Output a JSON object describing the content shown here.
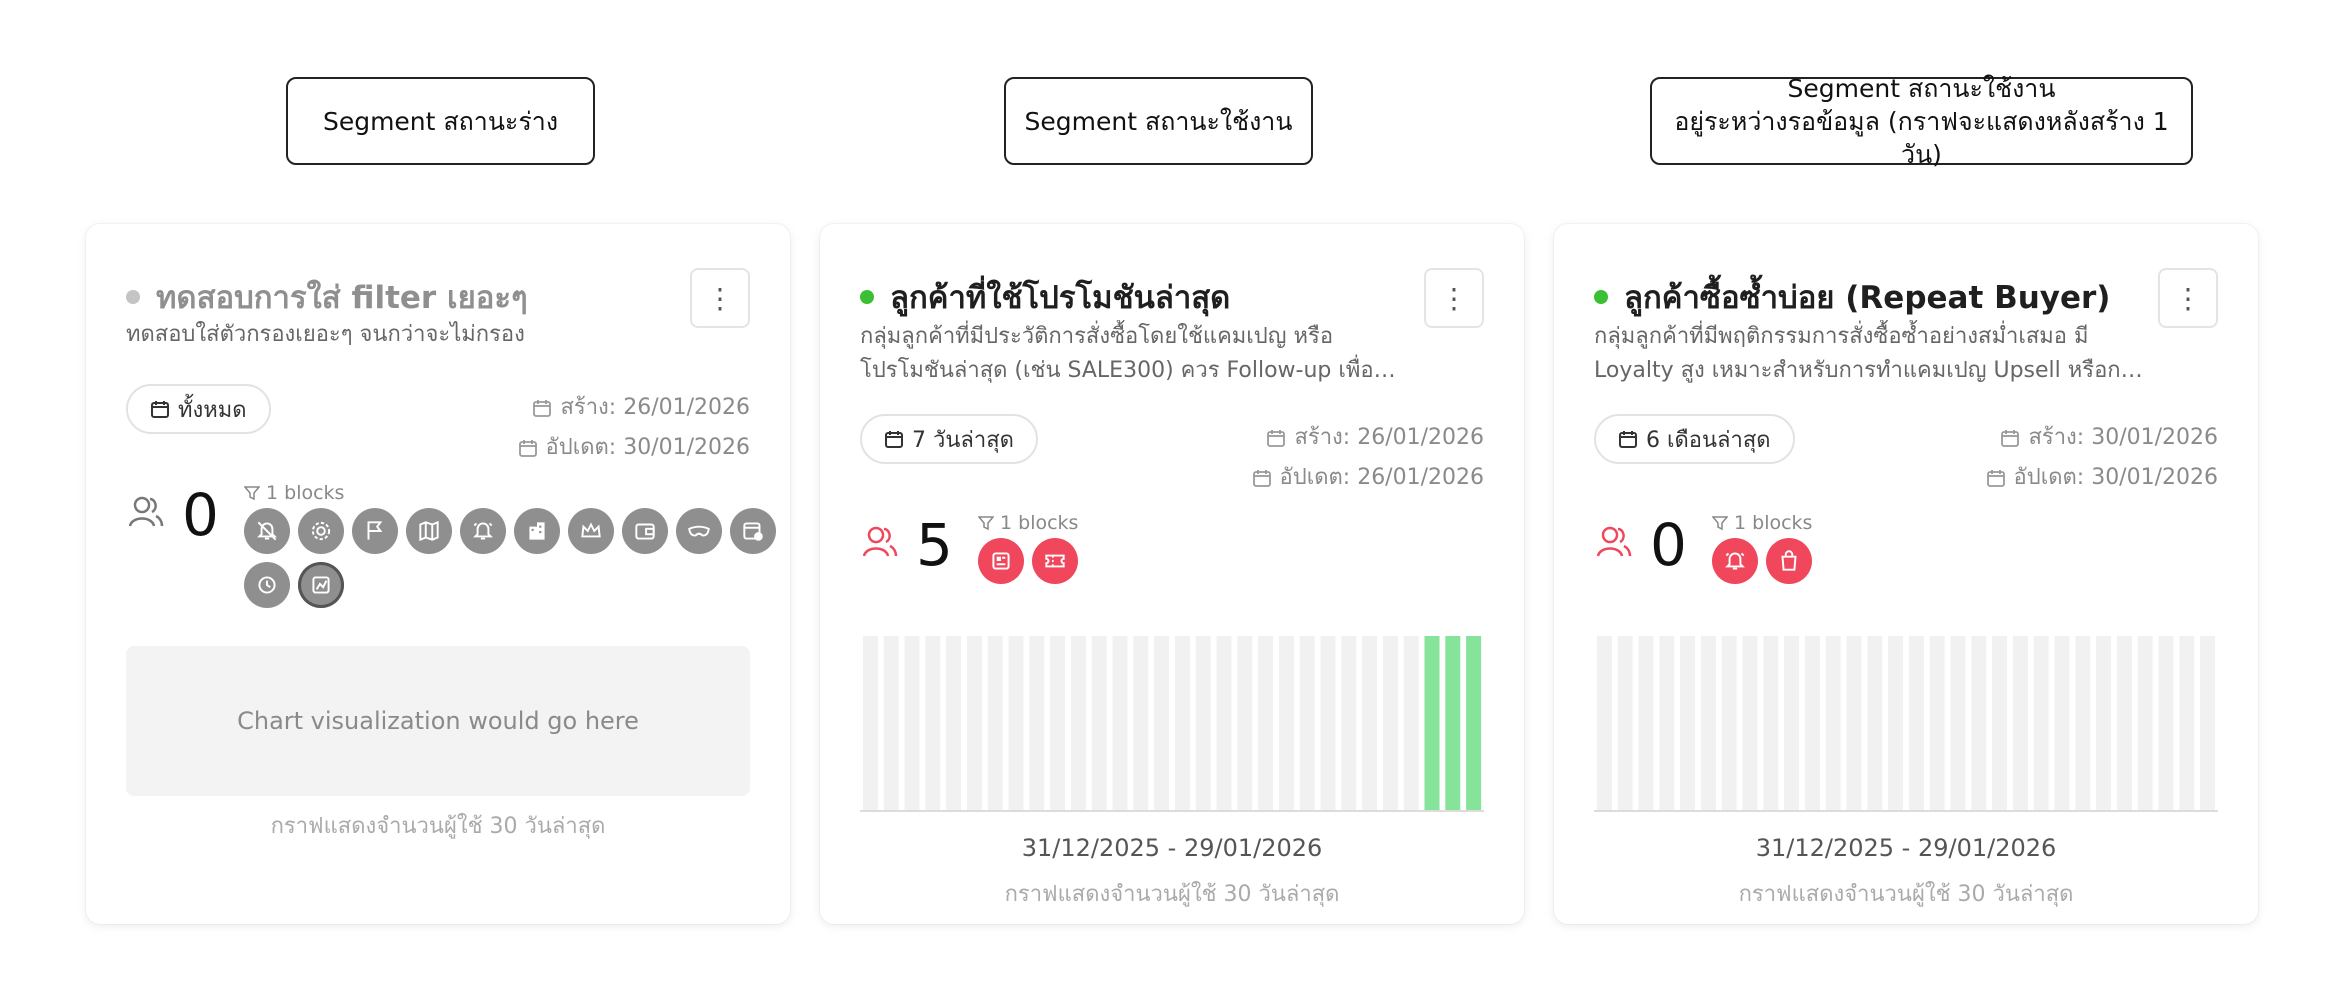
{
  "notes": [
    {
      "lines": [
        "Segment สถานะร่าง"
      ]
    },
    {
      "lines": [
        "Segment  สถานะใช้งาน"
      ]
    },
    {
      "lines": [
        "Segment สถานะใช้งาน",
        "อยู่ระหว่างรอข้อมูล (กราฟจะแสดงหลังสร้าง 1 วัน)"
      ]
    }
  ],
  "colors": {
    "active": "#3bbf35",
    "draft": "#c4c4c4",
    "accent": "#f0475c",
    "bar_empty": "#f1f1f1",
    "bar_filled": "#86e39a"
  },
  "cards": [
    {
      "status": "draft",
      "title": "ทดสอบการใส่ filter เยอะๆ",
      "description": "ทดสอบใส่ตัวกรองเยอะๆ จนกว่าจะไม่กรอง",
      "period": "ทั้งหมด",
      "created": "สร้าง: 26/01/2026",
      "updated": "อัปเดต: 30/01/2026",
      "count": "0",
      "blocks": "1 blocks",
      "block_icons": [
        "bell-off-icon",
        "settings-cog-icon",
        "flag-icon",
        "map-icon",
        "alarm-bell-icon",
        "building-icon",
        "crown-icon",
        "wallet-icon",
        "mask-icon",
        "calendar-clock-icon",
        "history-icon",
        "chart-box-icon"
      ],
      "chart_placeholder": "Chart visualization would go here",
      "caption": "กราฟแสดงจำนวนผู้ใช้ 30 วันล่าสุด"
    },
    {
      "status": "active",
      "title": "ลูกค้าที่ใช้โปรโมชันล่าสุด",
      "description": "กลุ่มลูกค้าที่มีประวัติการสั่งซื้อโดยใช้แคมเปญ หรือโปรโมชันล่าสุด (เช่น SALE300) ควร Follow-up เพื่อเสนอโปรโมชันต่อ",
      "period": "7 วันล่าสุด",
      "created": "สร้าง: 26/01/2026",
      "updated": "อัปเดต: 26/01/2026",
      "count": "5",
      "blocks": "1 blocks",
      "block_icons": [
        "profile-card-icon",
        "ticket-icon"
      ],
      "chart_data": {
        "type": "bar",
        "values": [
          0,
          0,
          0,
          0,
          0,
          0,
          0,
          0,
          0,
          0,
          0,
          0,
          0,
          0,
          0,
          0,
          0,
          0,
          0,
          0,
          0,
          0,
          0,
          0,
          0,
          0,
          0,
          1,
          1,
          1
        ],
        "ylim": [
          0,
          1
        ],
        "grid": false
      },
      "range": "31/12/2025 - 29/01/2026",
      "caption": "กราฟแสดงจำนวนผู้ใช้ 30 วันล่าสุด"
    },
    {
      "status": "active",
      "title": "ลูกค้าซื้อซ้ำบ่อย (Repeat Buyer)",
      "description": "กลุ่มลูกค้าที่มีพฤติกรรมการสั่งซื้อซ้ำอย่างสม่ำเสมอ มี Loyalty สูง เหมาะสำหรับการทำแคมเปญ Upsell หรือการตลาดแบบสมาชิก",
      "period": "6 เดือนล่าสุด",
      "created": "สร้าง: 30/01/2026",
      "updated": "อัปเดต: 30/01/2026",
      "count": "0",
      "blocks": "1 blocks",
      "block_icons": [
        "alarm-bell-icon",
        "shopping-bag-icon"
      ],
      "chart_data": {
        "type": "bar",
        "values": [
          0,
          0,
          0,
          0,
          0,
          0,
          0,
          0,
          0,
          0,
          0,
          0,
          0,
          0,
          0,
          0,
          0,
          0,
          0,
          0,
          0,
          0,
          0,
          0,
          0,
          0,
          0,
          0,
          0,
          0
        ],
        "ylim": [
          0,
          1
        ],
        "grid": false
      },
      "range": "31/12/2025 - 29/01/2026",
      "caption": "กราฟแสดงจำนวนผู้ใช้ 30 วันล่าสุด"
    }
  ]
}
